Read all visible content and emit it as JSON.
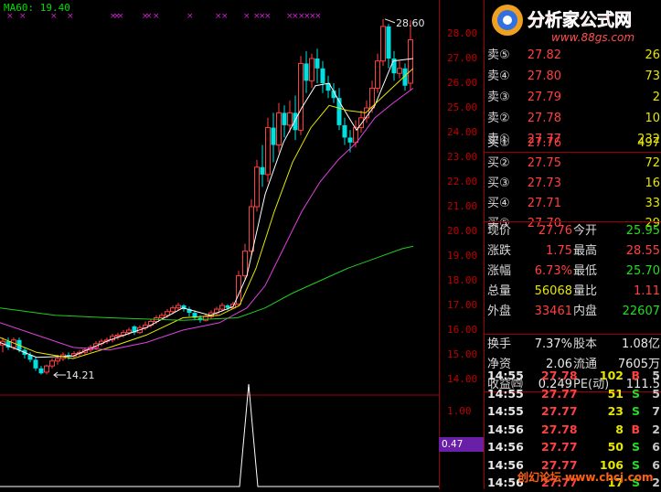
{
  "indicator": {
    "ma60_label": "MA60: 19.40"
  },
  "annotations": {
    "high_label": "28.60",
    "low_label": "14.21"
  },
  "price_axis": [
    "28.00",
    "27.00",
    "26.00",
    "25.00",
    "24.00",
    "23.00",
    "22.00",
    "21.00",
    "20.00",
    "19.00",
    "18.00",
    "17.00",
    "16.00",
    "15.00",
    "14.00"
  ],
  "volume_axis": [
    "1.00"
  ],
  "volume_current": "0.47",
  "sell_orders": [
    {
      "label": "卖⑤",
      "price": "27.82",
      "vol": "26"
    },
    {
      "label": "卖④",
      "price": "27.80",
      "vol": "73"
    },
    {
      "label": "卖③",
      "price": "27.79",
      "vol": "2"
    },
    {
      "label": "卖②",
      "price": "27.78",
      "vol": "10"
    },
    {
      "label": "卖①",
      "price": "27.77",
      "vol": "232"
    }
  ],
  "buy_orders": [
    {
      "label": "买①",
      "price": "27.76",
      "vol": "497"
    },
    {
      "label": "买②",
      "price": "27.75",
      "vol": "72"
    },
    {
      "label": "买③",
      "price": "27.73",
      "vol": "16"
    },
    {
      "label": "买④",
      "price": "27.71",
      "vol": "33"
    },
    {
      "label": "买⑤",
      "price": "27.70",
      "vol": "29"
    }
  ],
  "quote": [
    {
      "l1": "现价",
      "v1": "27.76",
      "l2": "今开",
      "v2": "25.95"
    },
    {
      "l1": "涨跌",
      "v1": "1.75",
      "l2": "最高",
      "v2": "28.55"
    },
    {
      "l1": "涨幅",
      "v1": "6.73%",
      "l2": "最低",
      "v2": "25.70"
    },
    {
      "l1": "总量",
      "v1": "56068",
      "l2": "量比",
      "v2": "1.11"
    },
    {
      "l1": "外盘",
      "v1": "33461",
      "l2": "内盘",
      "v2": "22607"
    }
  ],
  "fundamentals": [
    {
      "l1": "换手",
      "v1": "7.37%",
      "l2": "股本",
      "v2": "1.08亿"
    },
    {
      "l1": "净资",
      "v1": "2.06",
      "l2": "流通",
      "v2": "7605万"
    },
    {
      "l1": "收益㈣",
      "v1": "0.249",
      "l2": "PE(动)",
      "v2": "111.5"
    }
  ],
  "ticks": [
    {
      "time": "14:55",
      "price": "27.78",
      "vol": "102",
      "bs": "B",
      "n": "5"
    },
    {
      "time": "14:55",
      "price": "27.77",
      "vol": "51",
      "bs": "S",
      "n": "5"
    },
    {
      "time": "14:55",
      "price": "27.77",
      "vol": "23",
      "bs": "S",
      "n": "7"
    },
    {
      "time": "14:56",
      "price": "27.78",
      "vol": "8",
      "bs": "B",
      "n": "2"
    },
    {
      "time": "14:56",
      "price": "27.77",
      "vol": "50",
      "bs": "S",
      "n": "6"
    },
    {
      "time": "14:56",
      "price": "27.77",
      "vol": "106",
      "bs": "S",
      "n": "6"
    },
    {
      "time": "14:56",
      "price": "27.77",
      "vol": "17",
      "bs": "S",
      "n": "2"
    }
  ],
  "logo": {
    "brand": "分析家公式网",
    "url": "www.88gs.com"
  },
  "watermark": {
    "text": "创幻论坛 www.chcj.com"
  },
  "colors": {
    "up": "#ff4040",
    "down": "#00e0e0",
    "ma5": "#ffffff",
    "ma10": "#e6e600",
    "ma20": "#e040e0",
    "ma60": "#22cc22",
    "grid": "#a00000"
  }
}
